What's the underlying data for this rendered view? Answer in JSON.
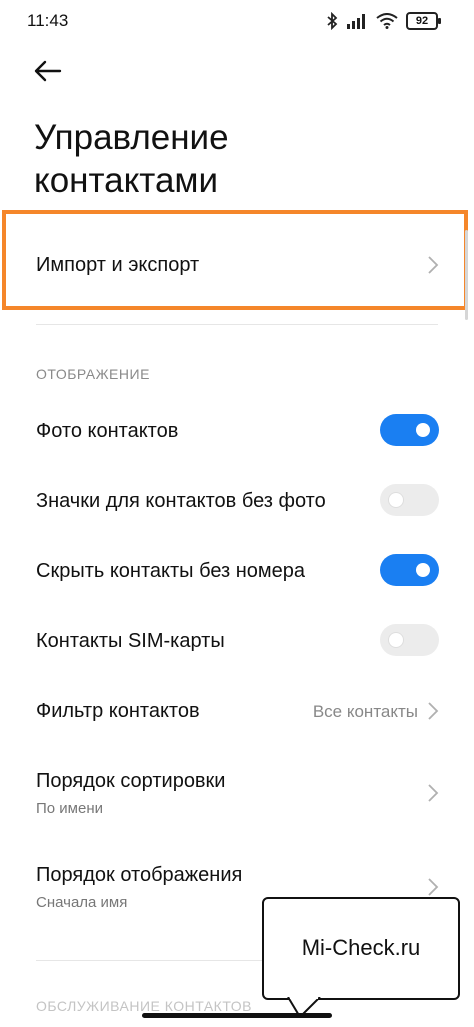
{
  "status_bar": {
    "time": "11:43",
    "battery": "92",
    "icons": [
      "bluetooth-icon",
      "signal-icon",
      "wifi-icon",
      "battery-icon"
    ]
  },
  "header": {
    "title_line1": "Управление",
    "title_line2": "контактами"
  },
  "import_export": {
    "label": "Импорт и экспорт"
  },
  "display_section": {
    "header": "ОТОБРАЖЕНИЕ"
  },
  "settings": [
    {
      "label": "Фото контактов",
      "toggle": true
    },
    {
      "label": "Значки для контактов без фото",
      "toggle": false
    },
    {
      "label": "Скрыть контакты без номера",
      "toggle": true
    },
    {
      "label": "Контакты SIM-карты",
      "toggle": false
    }
  ],
  "filter": {
    "label": "Фильтр контактов",
    "value": "Все контакты"
  },
  "sort_order": {
    "label": "Порядок сортировки",
    "sub": "По имени"
  },
  "display_order": {
    "label": "Порядок отображения",
    "sub": "Сначала имя"
  },
  "maintenance_section": {
    "header": "ОБСЛУЖИВАНИЕ КОНТАКТОВ"
  },
  "watermark": {
    "text": "Mi-Check.ru"
  },
  "colors": {
    "accent": "#1a7ff2",
    "highlight": "#f5862a"
  }
}
